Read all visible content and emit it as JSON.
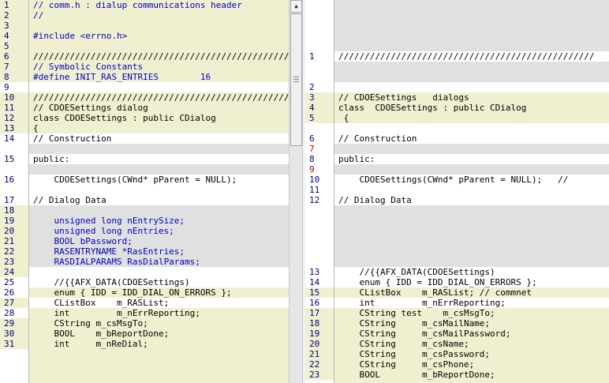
{
  "left_lines": [
    {
      "n": "1",
      "t": "// comm.h : dialup communications header",
      "bg": "chg",
      "blue": true
    },
    {
      "n": "2",
      "t": "//",
      "bg": "chg",
      "blue": true
    },
    {
      "n": "3",
      "t": "",
      "bg": "chg"
    },
    {
      "n": "4",
      "t": "#include <errno.h>",
      "bg": "chg",
      "blue": true
    },
    {
      "n": "5",
      "t": "",
      "bg": "chg"
    },
    {
      "n": "6",
      "t": "/////////////////////////////////////////////////",
      "bg": "chg"
    },
    {
      "n": "7",
      "t": "// Symbolic Constants",
      "bg": "chg",
      "blue": true
    },
    {
      "n": "8",
      "t": "#define INIT_RAS_ENTRIES        16",
      "bg": "chg",
      "blue": true
    },
    {
      "n": "9",
      "t": "",
      "bg": "none"
    },
    {
      "n": "10",
      "t": "/////////////////////////////////////////////////",
      "bg": "chg"
    },
    {
      "n": "11",
      "t": "// CDOESettings dialog",
      "bg": "chg"
    },
    {
      "n": "12",
      "t": "class CDOESettings : public CDialog",
      "bg": "chg"
    },
    {
      "n": "13",
      "t": "{",
      "bg": "chg"
    },
    {
      "n": "14",
      "t": "// Construction",
      "bg": "none"
    },
    {
      "n": "15",
      "t": "public:",
      "bg": "none"
    },
    {
      "n": "16",
      "t": "    CDOESettings(CWnd* pParent = NULL);",
      "bg": "none"
    },
    {
      "n": "17",
      "t": "// Dialog Data",
      "bg": "none"
    },
    {
      "n": "18",
      "t": "",
      "bg": "chg"
    },
    {
      "n": "19",
      "t": "    unsigned long nEntrySize;",
      "bg": "chg",
      "blue": true
    },
    {
      "n": "20",
      "t": "    unsigned long nEntries;",
      "bg": "chg",
      "blue": true
    },
    {
      "n": "21",
      "t": "    BOOL bPassword;",
      "bg": "chg",
      "blue": true
    },
    {
      "n": "22",
      "t": "    RASENTRYNAME *RasEntries;",
      "bg": "chg",
      "blue": true
    },
    {
      "n": "23",
      "t": "    RASDIALPARAMS RasDialParams;",
      "bg": "chg",
      "blue": true
    },
    {
      "n": "24",
      "t": "",
      "bg": "chg"
    },
    {
      "n": "25",
      "t": "    //{{AFX_DATA(CDOESettings)",
      "bg": "none"
    },
    {
      "n": "26",
      "t": "    enum { IDD = IDD_DIAL_ON_ERRORS };",
      "bg": "none"
    },
    {
      "n": "27",
      "t": "    CListBox    m_RASList;",
      "bg": "chg"
    },
    {
      "n": "28",
      "t": "    int         m_nErrReporting;",
      "bg": "none"
    },
    {
      "n": "29",
      "t": "    CString m_csMsgTo;",
      "bg": "chg"
    },
    {
      "n": "30",
      "t": "    BOOL    m_bReportDone;",
      "bg": "chg"
    },
    {
      "n": "31",
      "t": "    int     m_nReDial;",
      "bg": "chg"
    }
  ],
  "right_lines": [
    {
      "n": "1",
      "t": "/////////////////////////////////////////////////",
      "bg": "none"
    },
    {
      "n": "2",
      "t": "",
      "bg": "none"
    },
    {
      "n": "3",
      "t": "// CDOESettings   dialogs",
      "bg": "chg"
    },
    {
      "n": "4",
      "t": "class  CDOESettings : public CDialog",
      "bg": "chg"
    },
    {
      "n": "5",
      "t": " {",
      "bg": "chg"
    },
    {
      "n": "6",
      "t": "// Construction",
      "bg": "none"
    },
    {
      "n": "7",
      "t": "",
      "bg": "none",
      "red": true
    },
    {
      "n": "8",
      "t": "public:",
      "bg": "none"
    },
    {
      "n": "9",
      "t": "",
      "bg": "none",
      "red": true
    },
    {
      "n": "10",
      "t": "    CDOESettings(CWnd* pParent = NULL);   //",
      "bg": "none"
    },
    {
      "n": "11",
      "t": "",
      "bg": "none"
    },
    {
      "n": "12",
      "t": "// Dialog Data",
      "bg": "none"
    },
    {
      "n": "13",
      "t": "    //{{AFX_DATA(CDOESettings)",
      "bg": "none"
    },
    {
      "n": "14",
      "t": "    enum { IDD = IDD_DIAL_ON_ERRORS };",
      "bg": "none"
    },
    {
      "n": "15",
      "t": "    CListBox    m_RASList; // commnet",
      "bg": "chg"
    },
    {
      "n": "16",
      "t": "    int         m_nErrReporting;",
      "bg": "none"
    },
    {
      "n": "17",
      "t": "    CString test    m_csMsgTo;",
      "bg": "chg"
    },
    {
      "n": "18",
      "t": "    CString     m_csMailName;",
      "bg": "chg"
    },
    {
      "n": "19",
      "t": "    CString     m_csMailPassword;",
      "bg": "chg"
    },
    {
      "n": "20",
      "t": "    CString     m_csName;",
      "bg": "chg"
    },
    {
      "n": "21",
      "t": "    CString     m_csPassword;",
      "bg": "chg"
    },
    {
      "n": "22",
      "t": "    CString     m_csPhone;",
      "bg": "chg"
    },
    {
      "n": "23",
      "t": "    BOOL        m_bReportDone;",
      "bg": "chg"
    }
  ],
  "scrollbar": {
    "up_arrow": "▲",
    "grip": "≡"
  },
  "colors": {
    "changed": "#f0f0d0",
    "missing": "#e0e0e0",
    "line_number": "#000080",
    "keyword": "#0000c0"
  }
}
